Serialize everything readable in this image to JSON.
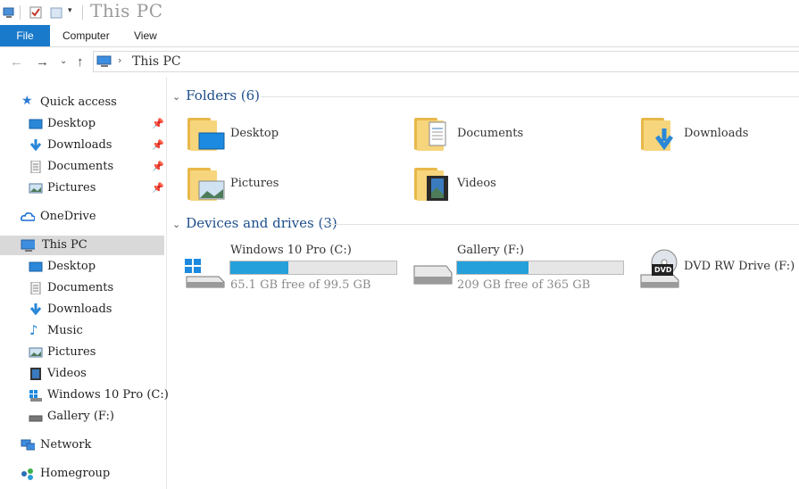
{
  "window": {
    "title": "This PC"
  },
  "ribbon": {
    "file_label": "File",
    "tabs": [
      "Computer",
      "View"
    ]
  },
  "address": {
    "path": "This PC"
  },
  "sidebar": {
    "quick_access": {
      "label": "Quick access",
      "items": [
        "Desktop",
        "Downloads",
        "Documents",
        "Pictures"
      ]
    },
    "onedrive": "OneDrive",
    "this_pc": {
      "label": "This PC",
      "items": [
        "Desktop",
        "Documents",
        "Downloads",
        "Music",
        "Pictures",
        "Videos",
        "Windows 10 Pro (C:)",
        "Gallery (F:)"
      ]
    },
    "network": "Network",
    "homegroup": "Homegroup"
  },
  "folders": {
    "header": "Folders (6)",
    "items": [
      "Desktop",
      "Documents",
      "Downloads",
      "Pictures",
      "Videos"
    ]
  },
  "devices": {
    "header": "Devices and drives (3)",
    "drives": [
      {
        "name": "Windows 10 Pro (C:)",
        "free_text": "65.1 GB free of 99.5 GB",
        "used_fraction": 0.35
      },
      {
        "name": "Gallery (F:)",
        "free_text": "209 GB free of 365 GB",
        "used_fraction": 0.43
      },
      {
        "name": "DVD RW Drive (F:)",
        "icon_text": "DVD"
      }
    ]
  },
  "colors": {
    "accent": "#1979ca",
    "bar_fill": "#26a0da",
    "folder": "#f6d57c",
    "header": "#1e4e8c"
  }
}
